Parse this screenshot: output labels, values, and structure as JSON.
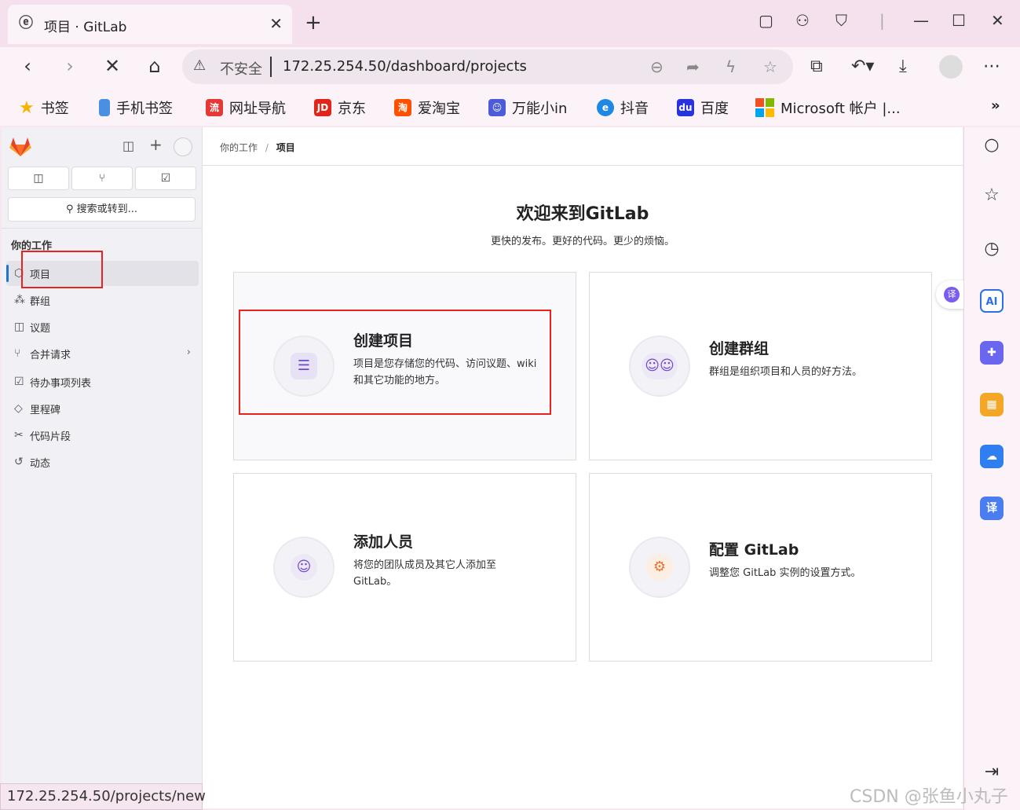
{
  "browser": {
    "tab_title": "项目 · GitLab",
    "address_insecure": "不安全",
    "address_url": "172.25.254.50/dashboard/projects",
    "status_url": "172.25.254.50/projects/new",
    "bookmarks": [
      {
        "label": "书签",
        "icon": "star-icon",
        "color": "#f4b400"
      },
      {
        "label": "手机书签",
        "icon": "phone-icon",
        "color": "#4a90e2"
      },
      {
        "label": "网址导航",
        "icon": "nav-icon",
        "color": "#e53935"
      },
      {
        "label": "京东",
        "icon": "jd-icon",
        "color": "#e1251b"
      },
      {
        "label": "爱淘宝",
        "icon": "taobao-icon",
        "color": "#ff5000"
      },
      {
        "label": "万能小in",
        "icon": "robot-icon",
        "color": "#4b5bd9"
      },
      {
        "label": "抖音",
        "icon": "edge-icon",
        "color": "#1e88e5"
      },
      {
        "label": "百度",
        "icon": "baidu-icon",
        "color": "#2932e1"
      },
      {
        "label": "Microsoft 帐户 |...",
        "icon": "microsoft-icon",
        "color": "#f25022"
      }
    ]
  },
  "sidebar": {
    "search_label": "搜索或转到...",
    "section_title": "你的工作",
    "items": [
      {
        "label": "项目",
        "icon": "project-icon"
      },
      {
        "label": "群组",
        "icon": "group-icon"
      },
      {
        "label": "议题",
        "icon": "issue-icon"
      },
      {
        "label": "合并请求",
        "icon": "merge-request-icon"
      },
      {
        "label": "待办事项列表",
        "icon": "todo-icon"
      },
      {
        "label": "里程碑",
        "icon": "milestone-icon"
      },
      {
        "label": "代码片段",
        "icon": "snippet-icon"
      },
      {
        "label": "动态",
        "icon": "activity-icon"
      }
    ]
  },
  "main": {
    "breadcrumb_root": "你的工作",
    "breadcrumb_current": "项目",
    "welcome_title": "欢迎来到GitLab",
    "tagline": "更快的发布。更好的代码。更少的烦恼。",
    "cards": [
      {
        "title": "创建项目",
        "desc": "项目是您存储您的代码、访问议题、wiki 和其它功能的地方。"
      },
      {
        "title": "创建群组",
        "desc": "群组是组织项目和人员的好方法。"
      },
      {
        "title": "添加人员",
        "desc": "将您的团队成员及其它人添加至 GitLab。"
      },
      {
        "title": "配置 GitLab",
        "desc": "调整您 GitLab 实例的设置方式。"
      }
    ]
  },
  "watermark": "CSDN @张鱼小丸子",
  "colors": {
    "accent": "#1f75cb",
    "highlight": "#e8231f",
    "gitlab_purple": "#6e49cb"
  }
}
